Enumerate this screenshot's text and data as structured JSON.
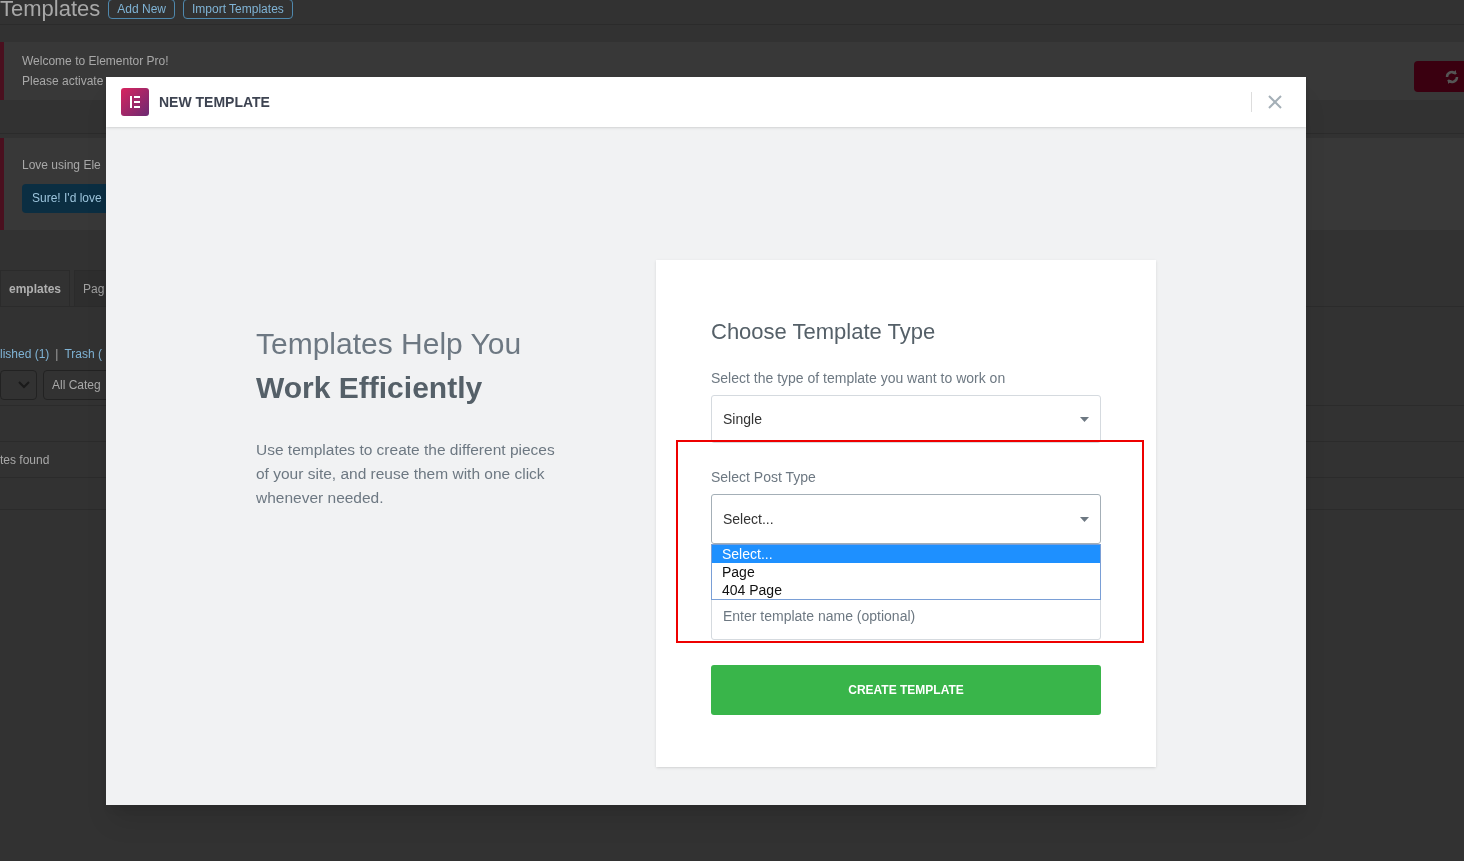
{
  "background_page": {
    "title": "Templates",
    "buttons": [
      "Add New",
      "Import Templates"
    ],
    "notices": [
      {
        "title": "Welcome to Elementor Pro!",
        "text": "Please activate"
      },
      {
        "title": "Love using Ele",
        "button": "Sure! I'd love"
      }
    ],
    "tabs": [
      {
        "label": "emplates",
        "selected": true
      },
      {
        "label": "Pag",
        "selected": false
      }
    ],
    "views": [
      "lished (1)",
      "|",
      "Trash ("
    ],
    "category_filter": "All Categ",
    "empty_message": "tes found"
  },
  "modal": {
    "title": "NEW TEMPLATE",
    "heading": "Templates Help You",
    "heading_bold": "Work Efficiently",
    "description": "Use templates to create the different pieces of your site, and reuse them with one click whenever needed.",
    "form": {
      "title": "Choose Template Type",
      "type_label": "Select the type of template you want to work on",
      "type_value": "Single",
      "post_type_label": "Select Post Type",
      "post_type_value": "Select...",
      "options": [
        {
          "label": "Select...",
          "selected": true
        },
        {
          "label": "Page",
          "selected": false
        },
        {
          "label": "404 Page",
          "selected": false
        }
      ],
      "name_placeholder": "Enter template name (optional)",
      "submit": "CREATE TEMPLATE"
    }
  }
}
